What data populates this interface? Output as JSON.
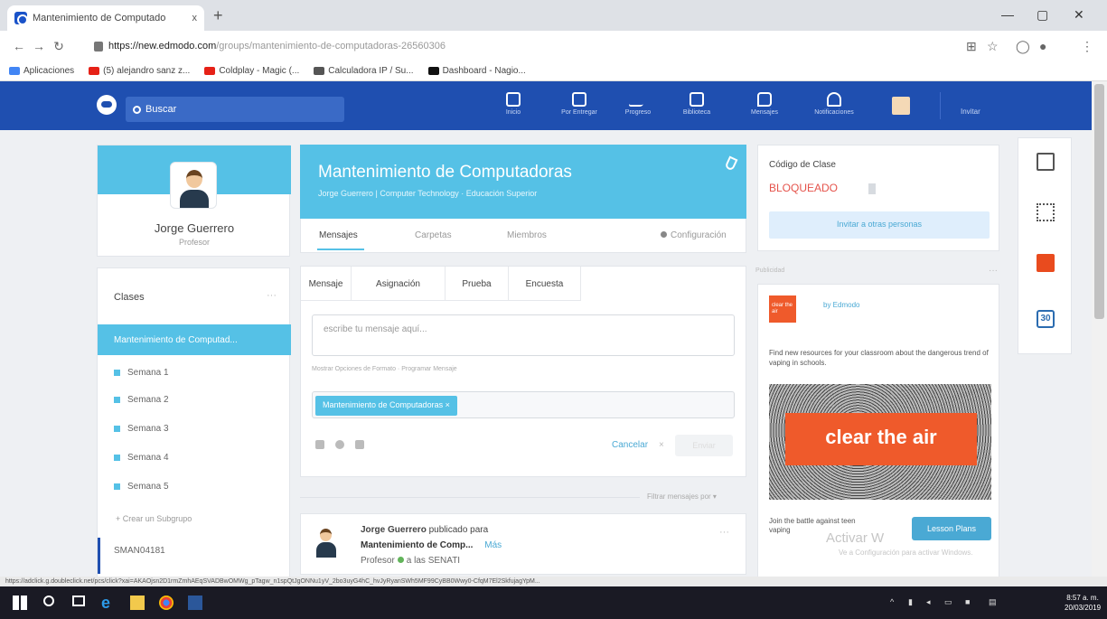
{
  "browser": {
    "tab_title": "Mantenimiento de Computado",
    "tab_close": "x",
    "new_tab": "+",
    "url_host": "https://new.edmodo.com",
    "url_path": "/groups/mantenimiento-de-computadoras-26560306",
    "bookmarks": [
      {
        "label": "Aplicaciones",
        "color": "#4285f4"
      },
      {
        "label": "(5) alejandro sanz z...",
        "color": "#e62117"
      },
      {
        "label": "Coldplay - Magic (...",
        "color": "#e62117"
      },
      {
        "label": "Calculadora IP / Su...",
        "color": "#555555"
      },
      {
        "label": "Dashboard - Nagio...",
        "color": "#111111"
      }
    ]
  },
  "topnav": {
    "search_placeholder": "Buscar",
    "items": [
      {
        "label": "Inicio"
      },
      {
        "label": "Por Entregar"
      },
      {
        "label": "Progreso"
      },
      {
        "label": "Biblioteca"
      },
      {
        "label": "Mensajes"
      },
      {
        "label": "Notificaciones"
      }
    ],
    "invite": "Invitar"
  },
  "profile": {
    "name": "Jorge Guerrero",
    "role": "Profesor"
  },
  "classes": {
    "title": "Clases",
    "more": "···",
    "active_class": "Mantenimiento de Computad...",
    "weeks": [
      "Semana 1",
      "Semana 2",
      "Semana 3",
      "Semana 4",
      "Semana 5"
    ],
    "create_subgroup": "+ Crear un Subgrupo",
    "other_class": "SMAN04181"
  },
  "class_header": {
    "title": "Mantenimiento de Computadoras",
    "subtitle": "Jorge Guerrero | Computer Technology · Educación Superior",
    "tabs": [
      "Mensajes",
      "Carpetas",
      "Miembros"
    ],
    "settings": "Configuración"
  },
  "composer": {
    "post_types": [
      "Mensaje",
      "Asignación",
      "Prueba",
      "Encuesta"
    ],
    "placeholder": "escribe tu mensaje aquí...",
    "format_options": "Mostrar Opciones de Formato · Programar Mensaje",
    "recipient_chip": "Mantenimiento de Computadoras ×",
    "cancel": "Cancelar",
    "cancel_x": "×",
    "send": "Enviar"
  },
  "feed": {
    "filter_label": "Filtrar mensajes por ▾",
    "post": {
      "author": "Jorge Guerrero",
      "posted_for": "publicado para",
      "target": "Mantenimiento de Comp...",
      "more_link": "Más",
      "role": "Profesor",
      "recipient": "a las SENATI",
      "dots": "···"
    }
  },
  "class_code": {
    "label": "Código de Clase",
    "value": "BLOQUEADO",
    "invite_button": "Invitar a otras personas"
  },
  "ad": {
    "label": "Publicidad",
    "dots": "···",
    "logo_text": "clear the air",
    "by": "by Edmodo",
    "text": "Find new resources for your classroom about the dangerous trend of vaping in schools.",
    "banner": "clear the air",
    "join_text": "Join the battle against teen vaping",
    "button": "Lesson Plans"
  },
  "watermark": {
    "line1": "Activar W",
    "line2": "Ve a Configuración para activar Windows."
  },
  "status_url": "https://adclick.g.doubleclick.net/pcs/click?xai=AKAOjsn2D1rmZmhAEqSVADBwOMWg_pTagw_n1spQtJgONNu1yV_2bo3uyG4hC_hvJyRyanSWh5MF99CyBB0Wwy0-CfqM7El2SkfujagYpM...",
  "taskbar": {
    "time": "8:57 a. m.",
    "date": "20/03/2019"
  },
  "colors": {
    "nav_blue": "#1f4fb0",
    "accent_cyan": "#55c1e6",
    "locked_red": "#e5534b",
    "ad_orange": "#ef5a2b"
  }
}
